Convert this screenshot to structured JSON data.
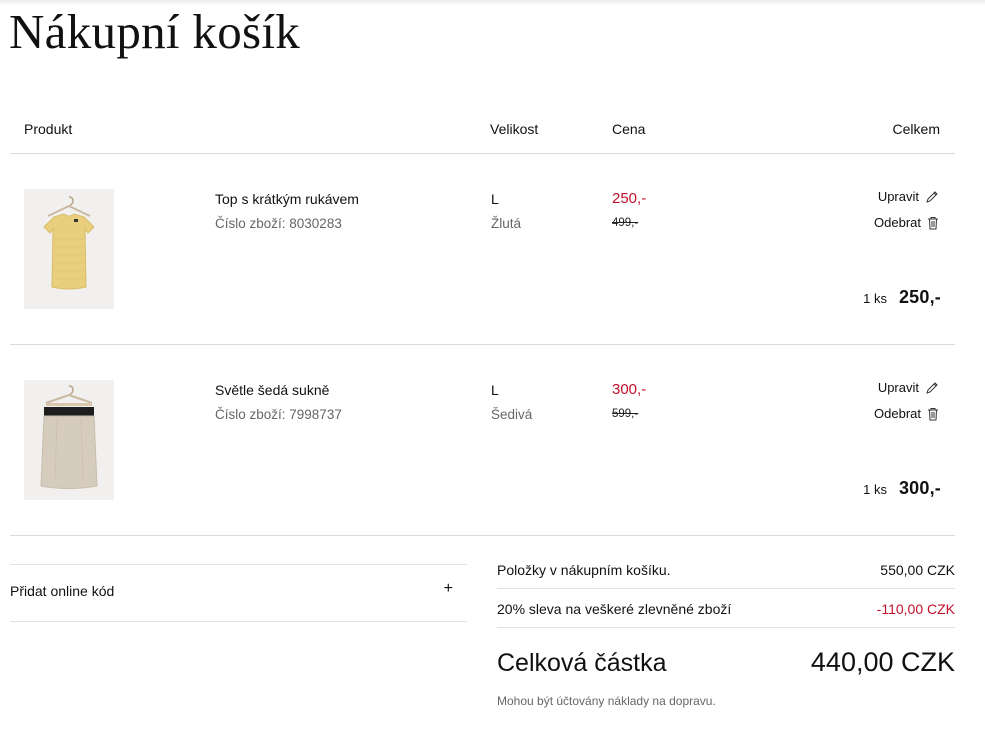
{
  "page": {
    "title": "Nákupní košík"
  },
  "table": {
    "headers": {
      "product": "Produkt",
      "size": "Velikost",
      "price": "Cena",
      "total": "Celkem"
    },
    "rows": [
      {
        "image_icon": "yellow-top-on-hanger",
        "name": "Top s krátkým rukávem",
        "article": "Číslo zboží: 8030283",
        "size": "L",
        "color": "Žlutá",
        "price": "250,-",
        "old_price": "499,-",
        "edit_label": "Upravit",
        "remove_label": "Odebrat",
        "quantity": "1 ks",
        "line_total": "250,-"
      },
      {
        "image_icon": "gray-skirt-on-hanger",
        "name": "Světle šedá sukně",
        "article": "Číslo zboží: 7998737",
        "size": "L",
        "color": "Šedivá",
        "price": "300,-",
        "old_price": "599,-",
        "edit_label": "Upravit",
        "remove_label": "Odebrat",
        "quantity": "1 ks",
        "line_total": "300,-"
      }
    ]
  },
  "promo": {
    "label": "Přidat online kód",
    "toggle": "+"
  },
  "summary": {
    "items_label": "Položky v nákupním košíku.",
    "items_value": "550,00 CZK",
    "discount_label": "20% sleva na veškeré zlevněné zboží",
    "discount_value": "-110,00 CZK",
    "total_label": "Celková částka",
    "total_value": "440,00 CZK",
    "note": "Mohou být účtovány náklady na dopravu."
  },
  "colors": {
    "sale_red": "#c2102a",
    "muted_text": "#666666",
    "divider": "#dcdcdc"
  }
}
